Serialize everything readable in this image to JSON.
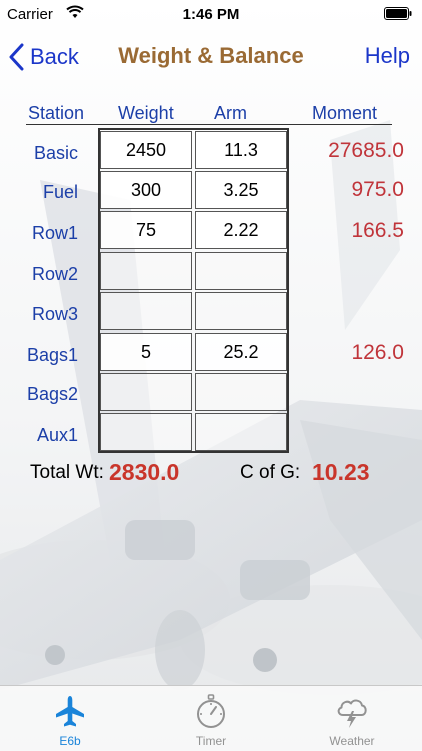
{
  "status_bar": {
    "carrier": "Carrier",
    "time": "1:46 PM"
  },
  "nav": {
    "back_label": "Back",
    "title": "Weight & Balance",
    "help_label": "Help"
  },
  "table": {
    "headers": {
      "station": "Station",
      "weight": "Weight",
      "arm": "Arm",
      "moment": "Moment"
    },
    "rows": [
      {
        "station": "Basic",
        "weight": "2450",
        "arm": "11.3",
        "moment": "27685.0"
      },
      {
        "station": "Fuel",
        "weight": "300",
        "arm": "3.25",
        "moment": "975.0"
      },
      {
        "station": "Row1",
        "weight": "75",
        "arm": "2.22",
        "moment": "166.5"
      },
      {
        "station": "Row2",
        "weight": "",
        "arm": "",
        "moment": ""
      },
      {
        "station": "Row3",
        "weight": "",
        "arm": "",
        "moment": ""
      },
      {
        "station": "Bags1",
        "weight": "5",
        "arm": "25.2",
        "moment": "126.0"
      },
      {
        "station": "Bags2",
        "weight": "",
        "arm": "",
        "moment": ""
      },
      {
        "station": "Aux1",
        "weight": "",
        "arm": "",
        "moment": ""
      }
    ]
  },
  "totals": {
    "total_wt_label": "Total Wt:",
    "total_wt_value": "2830.0",
    "cofg_label": "C of G:",
    "cofg_value": "10.23"
  },
  "tabs": [
    {
      "label": "E6b",
      "icon": "airplane-icon",
      "active": true
    },
    {
      "label": "Timer",
      "icon": "stopwatch-icon",
      "active": false
    },
    {
      "label": "Weather",
      "icon": "storm-cloud-icon",
      "active": false
    }
  ],
  "colors": {
    "link": "#1b36c9",
    "title": "#9a6a34",
    "label": "#1c3fa8",
    "moment": "#c0343a",
    "total": "#c9352b",
    "tab_active": "#1a84d9",
    "tab_inactive": "#929292"
  }
}
